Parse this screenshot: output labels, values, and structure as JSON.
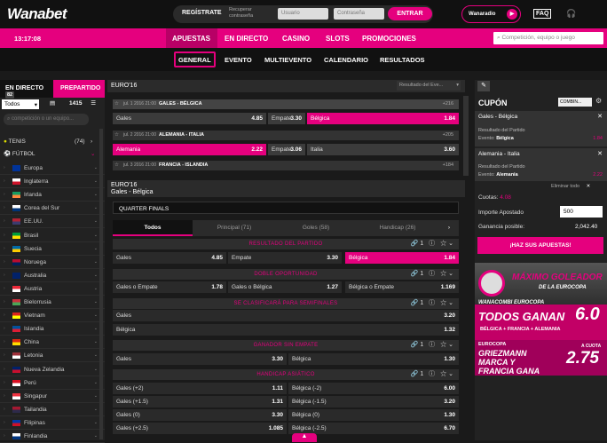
{
  "header": {
    "logo": "Wanabet",
    "register": "REGÍSTRATE",
    "recover": "Recuperar contraseña",
    "user_ph": "Usuario",
    "pass_ph": "Contraseña",
    "login": "ENTRAR",
    "radio": "Wanaradio",
    "faq": "FAQ"
  },
  "nav": {
    "time": "13:17:08",
    "items": [
      "APUESTAS",
      "EN DIRECTO",
      "CASINO",
      "SLOTS",
      "PROMOCIONES"
    ],
    "search_ph": "Competición, equipo o juego"
  },
  "subnav": [
    "GENERAL",
    "EVENTO",
    "MULTIEVENTO",
    "CALENDARIO",
    "RESULTADOS"
  ],
  "left": {
    "live": "EN DIRECTO",
    "live_count": "82",
    "pre": "PREPARTIDO",
    "filter": "Todos",
    "events": "1415",
    "search_ph": "competición o un equipo...",
    "sports": [
      {
        "name": "TENIS",
        "count": "(74)"
      },
      {
        "name": "FÚTBOL",
        "count": ""
      }
    ],
    "countries": [
      "Europa",
      "Inglaterra",
      "Irlanda",
      "Corea del Sur",
      "EE.UU.",
      "Brasil",
      "Suecia",
      "Noruega",
      "Australia",
      "Austria",
      "Bielorrusia",
      "Vietnam",
      "Islandia",
      "China",
      "Letonia",
      "Nueva Zelandia",
      "Perú",
      "Singapur",
      "Tailandia",
      "Filipinas",
      "Finlandia"
    ]
  },
  "center": {
    "competition": "EURO'16",
    "result_select": "Resultado del Eve...",
    "matches": [
      {
        "date": "jul. 1 2016 21:00",
        "title": "GALES - BÉLGICA",
        "more": "+216",
        "home": "Gales",
        "home_odd": "4.85",
        "draw": "Empate",
        "draw_odd": "3.30",
        "away": "Bélgica",
        "away_odd": "1.84"
      },
      {
        "date": "jul. 2 2016 21:00",
        "title": "ALEMANIA - ITALIA",
        "more": "+205",
        "home": "Alemania",
        "home_odd": "2.22",
        "draw": "Empate",
        "draw_odd": "3.06",
        "away": "Italia",
        "away_odd": "3.60"
      },
      {
        "date": "jul. 3 2016 21:00",
        "title": "FRANCIA - ISLANDIA",
        "more": "+184"
      }
    ],
    "event_comp": "EURO'16",
    "event_name": "Gales - Bélgica",
    "round": "QUARTER FINALS",
    "tabs": [
      "Todos",
      "Principal (71)",
      "Goles (58)",
      "Handicap (26)"
    ],
    "markets": {
      "resultado": "RESULTADO DEL PARTIDO",
      "r1": [
        "Gales",
        "4.85",
        "Empate",
        "3.30",
        "Bélgica",
        "1.84"
      ],
      "doble": "DOBLE OPORTUNIDAD",
      "d1": [
        "Gales o Empate",
        "1.78",
        "Gales o Bélgica",
        "1.27",
        "Bélgica o Empate",
        "1.169"
      ],
      "semis": "SE CLASIFICARÁ PARA SEMIFINALES",
      "s1": [
        "Gales",
        "3.20"
      ],
      "s2": [
        "Bélgica",
        "1.32"
      ],
      "sin_empate": "GANADOR SIN EMPATE",
      "e1": [
        "Gales",
        "3.30",
        "Bélgica",
        "1.30"
      ],
      "handicap": "HANDICAP ASIÁTICO",
      "h": [
        [
          "Gales (+2)",
          "1.11",
          "Bélgica (-2)",
          "6.00"
        ],
        [
          "Gales (+1.5)",
          "1.31",
          "Bélgica (-1.5)",
          "3.20"
        ],
        [
          "Gales (0)",
          "3.30",
          "Bélgica (0)",
          "1.30"
        ],
        [
          "Gales (+2.5)",
          "1.085",
          "Bélgica (-2.5)",
          "6.70"
        ]
      ],
      "count": "1"
    }
  },
  "coupon": {
    "title": "CUPÓN",
    "type": "COMBIN...",
    "bets": [
      {
        "title": "Gales - Bélgica",
        "market": "Resultado del Partido",
        "event": "Evento:",
        "pick": "Bélgica",
        "odd": "1.84"
      },
      {
        "title": "Alemania - Italia",
        "market": "Resultado del Partido",
        "event": "Evento:",
        "pick": "Alemania",
        "odd": "2.22"
      }
    ],
    "delete_all": "Eliminar todo",
    "cuotas_label": "Cuotas:",
    "cuotas": "4.08",
    "stake_label": "Importe Apostado",
    "stake": "500",
    "win_label": "Ganancia posible:",
    "win": "2,042.40",
    "cta": "¡HAZ SUS APUESTAS!"
  },
  "ads": {
    "a1_line1": "MÁXIMO GOLEADOR",
    "a1_line2": "DE LA EUROCOPA",
    "a1_brand": "WANACOMBI EUROCOPA",
    "a1_big": "TODOS GANAN",
    "a1_odd": "6.0",
    "a1_teams": "BÉLGICA + FRANCIA + ALEMANIA",
    "a2_brand": "EUROCOPA",
    "a2_big": "GRIEZMANN MARCA Y FRANCIA GANA",
    "a2_odd": "2.75",
    "a2_note": "A CUOTA"
  }
}
